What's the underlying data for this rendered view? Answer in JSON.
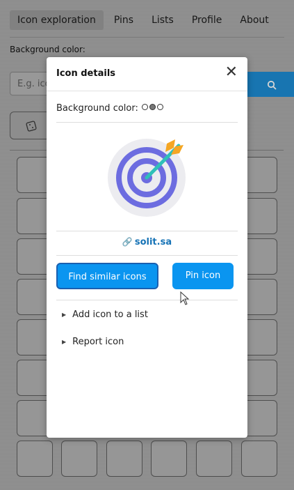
{
  "nav": {
    "tabs": [
      "Icon exploration",
      "Pins",
      "Lists",
      "Profile",
      "About"
    ]
  },
  "background": {
    "bg_label": "Background color:",
    "search_placeholder": "E.g. ico",
    "search_icon": "search-icon",
    "random_icon": "dice-icon"
  },
  "modal": {
    "title": "Icon details",
    "close_icon": "close-icon",
    "bg_label": "Background color:",
    "swatch_colors": [
      "#ffffff",
      "#777777",
      "#ffffff"
    ],
    "preview_icon": "target-with-arrow-icon",
    "link_icon": "link-icon",
    "link_text": "solit.sa",
    "find_similar_label": "Find similar icons",
    "pin_label": "Pin icon",
    "add_to_list_label": "Add icon to a list",
    "report_label": "Report icon"
  },
  "colors": {
    "accent": "#0a95f0",
    "link": "#1673b6",
    "target_purple": "#6c6ce0",
    "arrow_orange": "#f5a623",
    "arrow_teal": "#2fc0b8"
  }
}
